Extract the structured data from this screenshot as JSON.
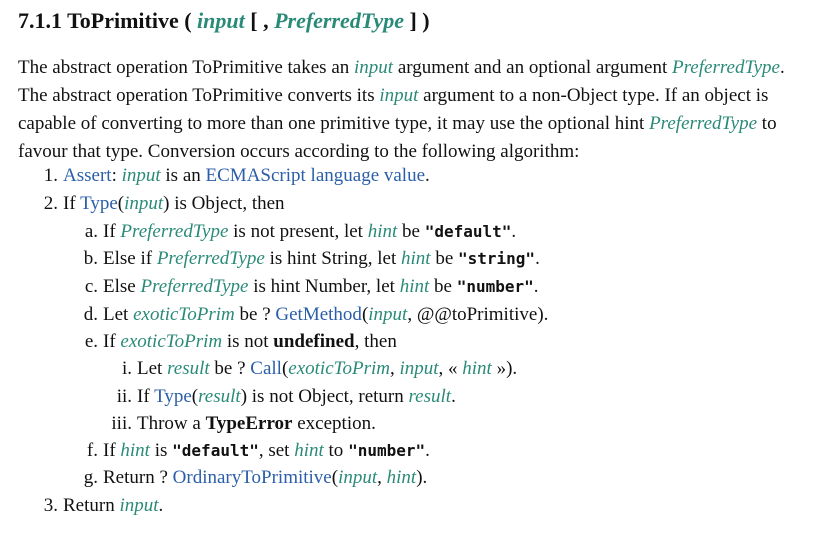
{
  "colors": {
    "var": "#2a8a78",
    "link": "#2a5ea8"
  },
  "title": [
    [
      "7.1.1  ToPrimitive ( ",
      "n"
    ],
    [
      "input",
      "v"
    ],
    [
      " [ , ",
      "n"
    ],
    [
      "PreferredType",
      "v"
    ],
    [
      " ] )",
      "n"
    ]
  ],
  "paragraph": [
    [
      "The abstract operation ToPrimitive takes an ",
      "n"
    ],
    [
      "input",
      "v"
    ],
    [
      " argument and an optional argument ",
      "n"
    ],
    [
      "PreferredType",
      "v"
    ],
    [
      ". The abstract operation ToPrimitive converts its ",
      "n"
    ],
    [
      "input",
      "v"
    ],
    [
      " argument to a non-Object type. If an object is capable of converting to more than one primitive type, it may use the optional hint ",
      "n"
    ],
    [
      "PreferredType",
      "v"
    ],
    [
      " to favour that type. Conversion occurs according to the following algorithm:",
      "n"
    ]
  ],
  "steps": [
    {
      "num": "1.",
      "level": 1,
      "segs": [
        [
          "Assert",
          "l"
        ],
        [
          ": ",
          "n"
        ],
        [
          "input",
          "v"
        ],
        [
          " is an ",
          "n"
        ],
        [
          "ECMAScript language value",
          "l"
        ],
        [
          ".",
          "n"
        ]
      ]
    },
    {
      "num": "2.",
      "level": 1,
      "segs": [
        [
          "If ",
          "n"
        ],
        [
          "Type",
          "l"
        ],
        [
          "(",
          "n"
        ],
        [
          "input",
          "v"
        ],
        [
          ") is Object, then",
          "n"
        ]
      ]
    },
    {
      "num": "a.",
      "level": 2,
      "segs": [
        [
          "If ",
          "n"
        ],
        [
          "PreferredType",
          "v"
        ],
        [
          " is not present, let ",
          "n"
        ],
        [
          "hint",
          "v"
        ],
        [
          " be ",
          "n"
        ],
        [
          "\"default\"",
          "c"
        ],
        [
          ".",
          "n"
        ]
      ]
    },
    {
      "num": "b.",
      "level": 2,
      "segs": [
        [
          "Else if ",
          "n"
        ],
        [
          "PreferredType",
          "v"
        ],
        [
          " is hint String, let ",
          "n"
        ],
        [
          "hint",
          "v"
        ],
        [
          " be ",
          "n"
        ],
        [
          "\"string\"",
          "c"
        ],
        [
          ".",
          "n"
        ]
      ]
    },
    {
      "num": "c.",
      "level": 2,
      "segs": [
        [
          "Else ",
          "n"
        ],
        [
          "PreferredType",
          "v"
        ],
        [
          " is hint Number, let ",
          "n"
        ],
        [
          "hint",
          "v"
        ],
        [
          " be ",
          "n"
        ],
        [
          "\"number\"",
          "c"
        ],
        [
          ".",
          "n"
        ]
      ]
    },
    {
      "num": "d.",
      "level": 2,
      "segs": [
        [
          "Let ",
          "n"
        ],
        [
          "exoticToPrim",
          "v"
        ],
        [
          " be ? ",
          "n"
        ],
        [
          "GetMethod",
          "l"
        ],
        [
          "(",
          "n"
        ],
        [
          "input",
          "v"
        ],
        [
          ", @@toPrimitive).",
          "n"
        ]
      ]
    },
    {
      "num": "e.",
      "level": 2,
      "segs": [
        [
          "If ",
          "n"
        ],
        [
          "exoticToPrim",
          "v"
        ],
        [
          " is not ",
          "n"
        ],
        [
          "undefined",
          "b"
        ],
        [
          ", then",
          "n"
        ]
      ]
    },
    {
      "num": "i.",
      "level": 3,
      "segs": [
        [
          "Let ",
          "n"
        ],
        [
          "result",
          "v"
        ],
        [
          " be ? ",
          "n"
        ],
        [
          "Call",
          "l"
        ],
        [
          "(",
          "n"
        ],
        [
          "exoticToPrim",
          "v"
        ],
        [
          ", ",
          "n"
        ],
        [
          "input",
          "v"
        ],
        [
          ", « ",
          "n"
        ],
        [
          "hint",
          "v"
        ],
        [
          " »).",
          "n"
        ]
      ]
    },
    {
      "num": "ii.",
      "level": 3,
      "segs": [
        [
          "If ",
          "n"
        ],
        [
          "Type",
          "l"
        ],
        [
          "(",
          "n"
        ],
        [
          "result",
          "v"
        ],
        [
          ") is not Object, return ",
          "n"
        ],
        [
          "result",
          "v"
        ],
        [
          ".",
          "n"
        ]
      ]
    },
    {
      "num": "iii.",
      "level": 3,
      "segs": [
        [
          "Throw a ",
          "n"
        ],
        [
          "TypeError",
          "b"
        ],
        [
          " exception.",
          "n"
        ]
      ]
    },
    {
      "num": "f.",
      "level": 2,
      "segs": [
        [
          "If ",
          "n"
        ],
        [
          "hint",
          "v"
        ],
        [
          " is ",
          "n"
        ],
        [
          "\"default\"",
          "c"
        ],
        [
          ", set ",
          "n"
        ],
        [
          "hint",
          "v"
        ],
        [
          " to ",
          "n"
        ],
        [
          "\"number\"",
          "c"
        ],
        [
          ".",
          "n"
        ]
      ]
    },
    {
      "num": "g.",
      "level": 2,
      "segs": [
        [
          "Return ? ",
          "n"
        ],
        [
          "OrdinaryToPrimitive",
          "l"
        ],
        [
          "(",
          "n"
        ],
        [
          "input",
          "v"
        ],
        [
          ", ",
          "n"
        ],
        [
          "hint",
          "v"
        ],
        [
          ").",
          "n"
        ]
      ]
    },
    {
      "num": "3.",
      "level": 1,
      "segs": [
        [
          "Return ",
          "n"
        ],
        [
          "input",
          "v"
        ],
        [
          ".",
          "n"
        ]
      ]
    }
  ]
}
